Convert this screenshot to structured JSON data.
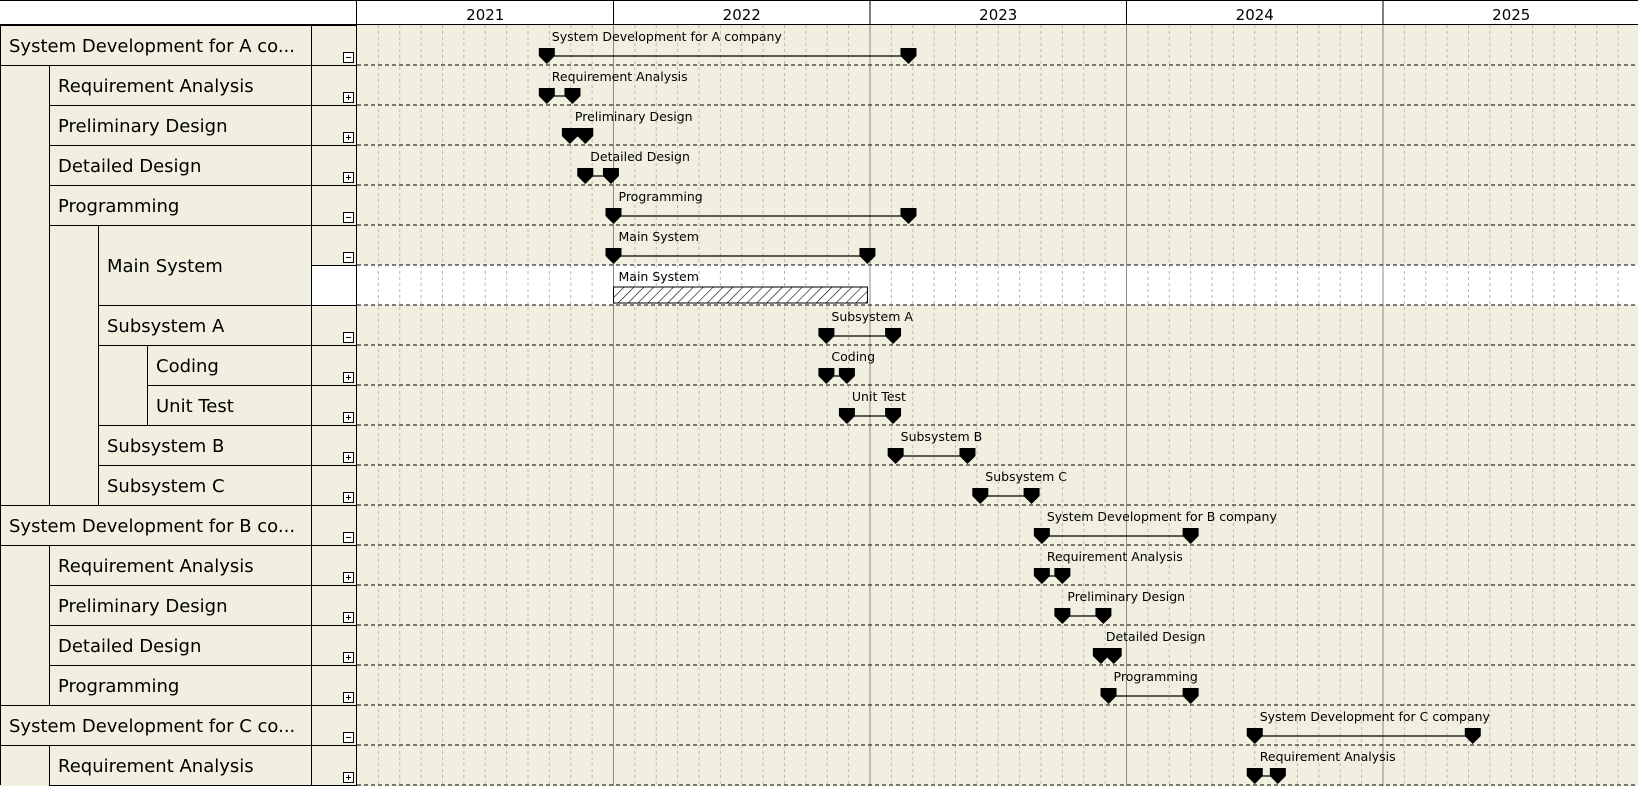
{
  "timeline": {
    "years": [
      "2021",
      "2022",
      "2023",
      "2024",
      "2025"
    ],
    "subdivisions_per_year": 12,
    "visible_range": [
      2020.52,
      2025.9
    ]
  },
  "colors": {
    "background": "#f1f0e0",
    "selected_row": "#ffffff",
    "marker": "#000000",
    "grid": "#b9b9b9"
  },
  "rows": [
    {
      "label": "System Development for A co...",
      "level": 0,
      "toggle": "minus",
      "bar_label": "System Development for A company",
      "start": 2021.74,
      "end": 2023.15,
      "kind": "span"
    },
    {
      "label": "Requirement Analysis",
      "level": 1,
      "toggle": "plus",
      "bar_label": "Requirement Analysis",
      "start": 2021.74,
      "end": 2021.84,
      "kind": "span"
    },
    {
      "label": "Preliminary Design",
      "level": 1,
      "toggle": "plus",
      "bar_label": "Preliminary Design",
      "start": 2021.83,
      "end": 2021.89,
      "kind": "span"
    },
    {
      "label": "Detailed Design",
      "level": 1,
      "toggle": "plus",
      "bar_label": "Detailed Design",
      "start": 2021.89,
      "end": 2021.99,
      "kind": "span"
    },
    {
      "label": "Programming",
      "level": 1,
      "toggle": "minus",
      "bar_label": "Programming",
      "start": 2022.0,
      "end": 2023.15,
      "kind": "span"
    },
    {
      "label": "Main System",
      "level": 2,
      "toggle": "minus",
      "bar_label": "Main System",
      "start": 2022.0,
      "end": 2022.99,
      "kind": "span",
      "row_span": 2
    },
    {
      "label": "",
      "level": 2,
      "toggle": "none",
      "bar_label": "Main System",
      "start": 2022.0,
      "end": 2022.99,
      "kind": "hatched",
      "selected": true
    },
    {
      "label": "Subsystem A",
      "level": 2,
      "toggle": "minus",
      "bar_label": "Subsystem A",
      "start": 2022.83,
      "end": 2023.09,
      "kind": "span"
    },
    {
      "label": "Coding",
      "level": 3,
      "toggle": "plus",
      "bar_label": "Coding",
      "start": 2022.83,
      "end": 2022.91,
      "kind": "span"
    },
    {
      "label": "Unit Test",
      "level": 3,
      "toggle": "plus",
      "bar_label": "Unit Test",
      "start": 2022.91,
      "end": 2023.09,
      "kind": "span"
    },
    {
      "label": "Subsystem B",
      "level": 2,
      "toggle": "plus",
      "bar_label": "Subsystem B",
      "start": 2023.1,
      "end": 2023.38,
      "kind": "span"
    },
    {
      "label": "Subsystem C",
      "level": 2,
      "toggle": "plus",
      "bar_label": "Subsystem C",
      "start": 2023.43,
      "end": 2023.63,
      "kind": "span"
    },
    {
      "label": "System Development for B co...",
      "level": 0,
      "toggle": "minus",
      "bar_label": "System Development for B company",
      "start": 2023.67,
      "end": 2024.25,
      "kind": "span"
    },
    {
      "label": "Requirement Analysis",
      "level": 1,
      "toggle": "plus",
      "bar_label": "Requirement Analysis",
      "start": 2023.67,
      "end": 2023.75,
      "kind": "span"
    },
    {
      "label": "Preliminary Design",
      "level": 1,
      "toggle": "plus",
      "bar_label": "Preliminary Design",
      "start": 2023.75,
      "end": 2023.91,
      "kind": "span"
    },
    {
      "label": "Detailed Design",
      "level": 1,
      "toggle": "plus",
      "bar_label": "Detailed Design",
      "start": 2023.9,
      "end": 2023.95,
      "kind": "span"
    },
    {
      "label": "Programming",
      "level": 1,
      "toggle": "plus",
      "bar_label": "Programming",
      "start": 2023.93,
      "end": 2024.25,
      "kind": "span"
    },
    {
      "label": "System Development for C co...",
      "level": 0,
      "toggle": "minus",
      "bar_label": "System Development for C company",
      "start": 2024.5,
      "end": 2025.35,
      "kind": "span"
    },
    {
      "label": "Requirement Analysis",
      "level": 1,
      "toggle": "plus",
      "bar_label": "Requirement Analysis",
      "start": 2024.5,
      "end": 2024.59,
      "kind": "span"
    }
  ]
}
